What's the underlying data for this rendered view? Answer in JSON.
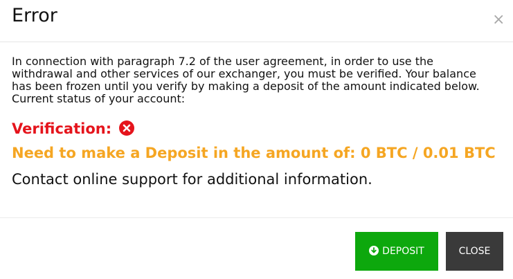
{
  "dialog": {
    "title": "Error",
    "close_glyph": "×"
  },
  "body": {
    "paragraph": "In connection with paragraph 7.2 of the user agreement, in order to use the withdrawal and other services of our exchanger, you must be verified. Your balance has been frozen until you verify by making a deposit of the amount indicated below.",
    "status_line": "Current status of your account:",
    "verification_label": "Verification:",
    "verification_icon": "x-circle-icon",
    "deposit_text": "Need to make a Deposit in the amount of: 0 BTC / 0.01 BTC",
    "contact_text": "Contact online support for additional information."
  },
  "footer": {
    "deposit_label": "Deposit",
    "deposit_icon": "download-circle-icon",
    "close_label": "Close"
  },
  "colors": {
    "verification_red": "#e5141c",
    "deposit_orange": "#f5a623",
    "deposit_button_green": "#0da80d",
    "close_button_dark": "#3a3a3a"
  }
}
